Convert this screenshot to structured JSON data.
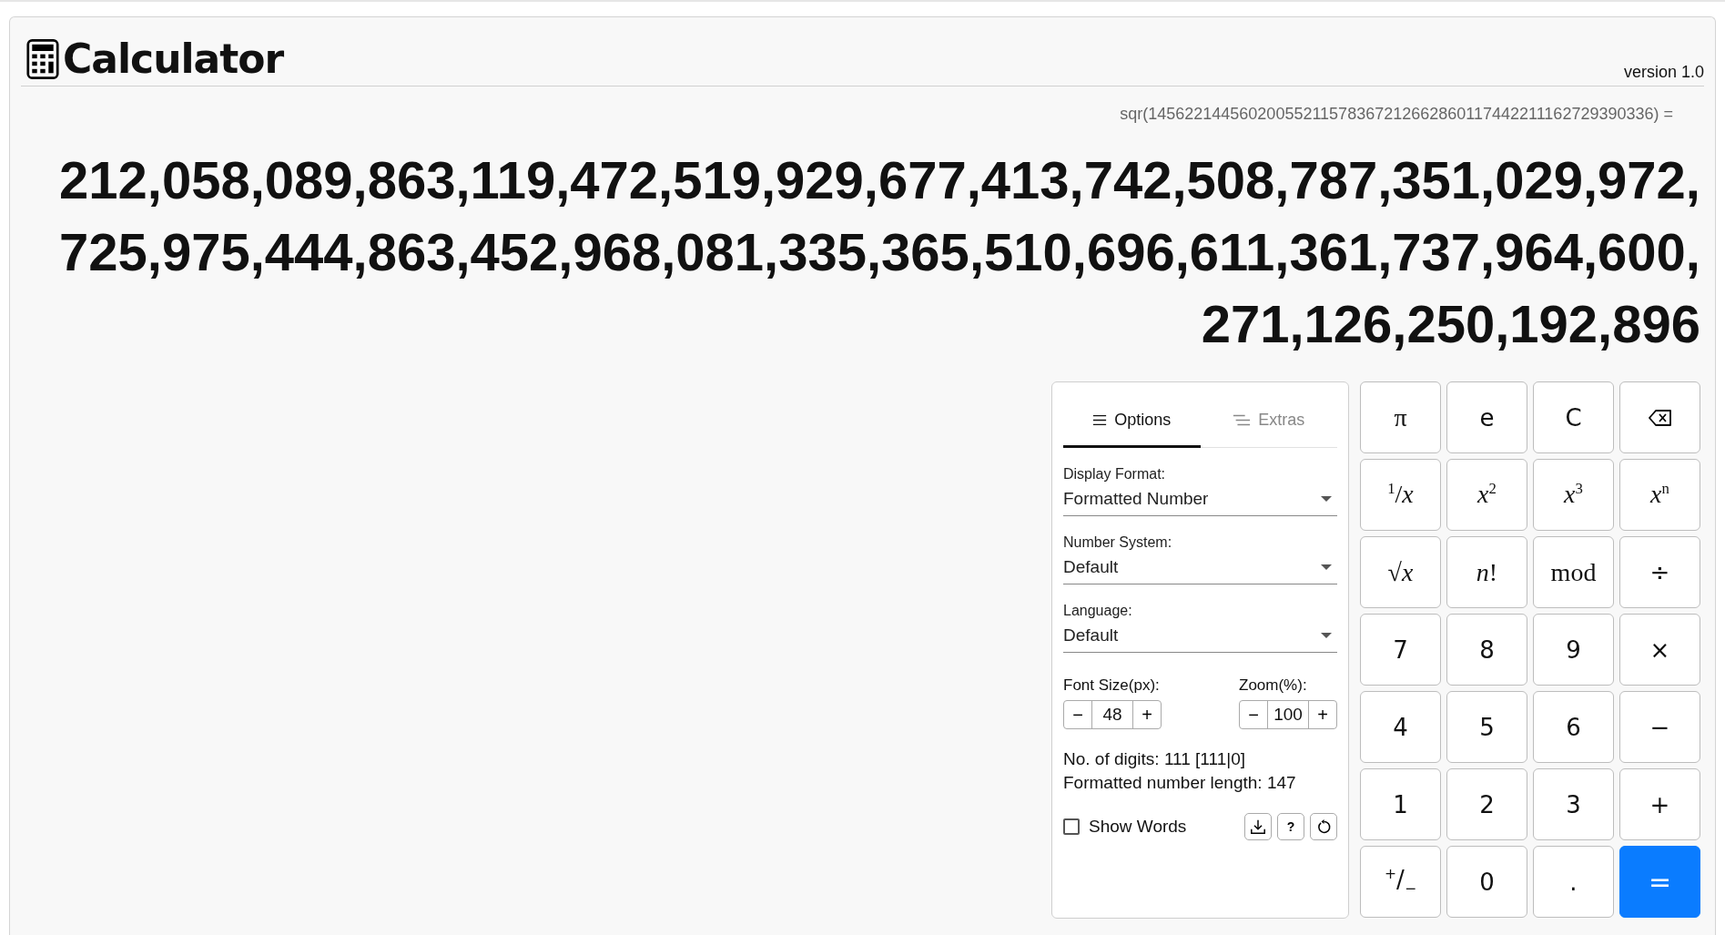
{
  "header": {
    "title": "Calculator",
    "version": "version 1.0"
  },
  "expression": "sqr(14562214456020055211578367212662860117442211162729390336) =",
  "result": "212,058,089,863,119,472,519,929,677,413,742,508,787,351,029,972,725,975,444,863,452,968,081,335,365,510,696,611,361,737,964,600,271,126,250,192,896",
  "options_panel": {
    "tabs": [
      {
        "label": "Options",
        "selected": true
      },
      {
        "label": "Extras",
        "selected": false
      }
    ],
    "selects": [
      {
        "label": "Display Format:",
        "value": "Formatted Number"
      },
      {
        "label": "Number System:",
        "value": "Default"
      },
      {
        "label": "Language:",
        "value": "Default"
      }
    ],
    "steppers": [
      {
        "label": "Font Size(px):",
        "value": "48",
        "minus": "−",
        "plus": "+"
      },
      {
        "label": "Zoom(%):",
        "value": "100",
        "minus": "−",
        "plus": "+"
      }
    ],
    "info": [
      "No. of digits: 111 [111|0]",
      "Formatted number length: 147"
    ],
    "show_words": {
      "label": "Show Words",
      "checked": false
    },
    "tool_buttons": [
      {
        "kind": "download"
      },
      {
        "kind": "help",
        "label": "?"
      },
      {
        "kind": "reset"
      }
    ]
  },
  "keypad": [
    {
      "kind": "math",
      "label": "π"
    },
    {
      "kind": "text",
      "label": "e"
    },
    {
      "kind": "text",
      "label": "C"
    },
    {
      "kind": "backspace"
    },
    {
      "kind": "math",
      "label": "$^{1}$/*x*"
    },
    {
      "kind": "math",
      "label": "*x*$^{2}$"
    },
    {
      "kind": "math",
      "label": "*x*$^{3}$"
    },
    {
      "kind": "math",
      "label": "*x*$^{n}$"
    },
    {
      "kind": "math",
      "label": "√*x*"
    },
    {
      "kind": "math",
      "label": "*n*!"
    },
    {
      "kind": "math",
      "label": "mod"
    },
    {
      "kind": "text",
      "label": "÷"
    },
    {
      "kind": "text",
      "label": "7"
    },
    {
      "kind": "text",
      "label": "8"
    },
    {
      "kind": "text",
      "label": "9"
    },
    {
      "kind": "text",
      "label": "×"
    },
    {
      "kind": "text",
      "label": "4"
    },
    {
      "kind": "text",
      "label": "5"
    },
    {
      "kind": "text",
      "label": "6"
    },
    {
      "kind": "text",
      "label": "−"
    },
    {
      "kind": "text",
      "label": "1"
    },
    {
      "kind": "text",
      "label": "2"
    },
    {
      "kind": "text",
      "label": "3"
    },
    {
      "kind": "text",
      "label": "+"
    },
    {
      "kind": "text",
      "label": "$^{+}$/$_{−}$"
    },
    {
      "kind": "text",
      "label": "0"
    },
    {
      "kind": "text",
      "label": "."
    },
    {
      "kind": "equals",
      "label": "="
    }
  ]
}
